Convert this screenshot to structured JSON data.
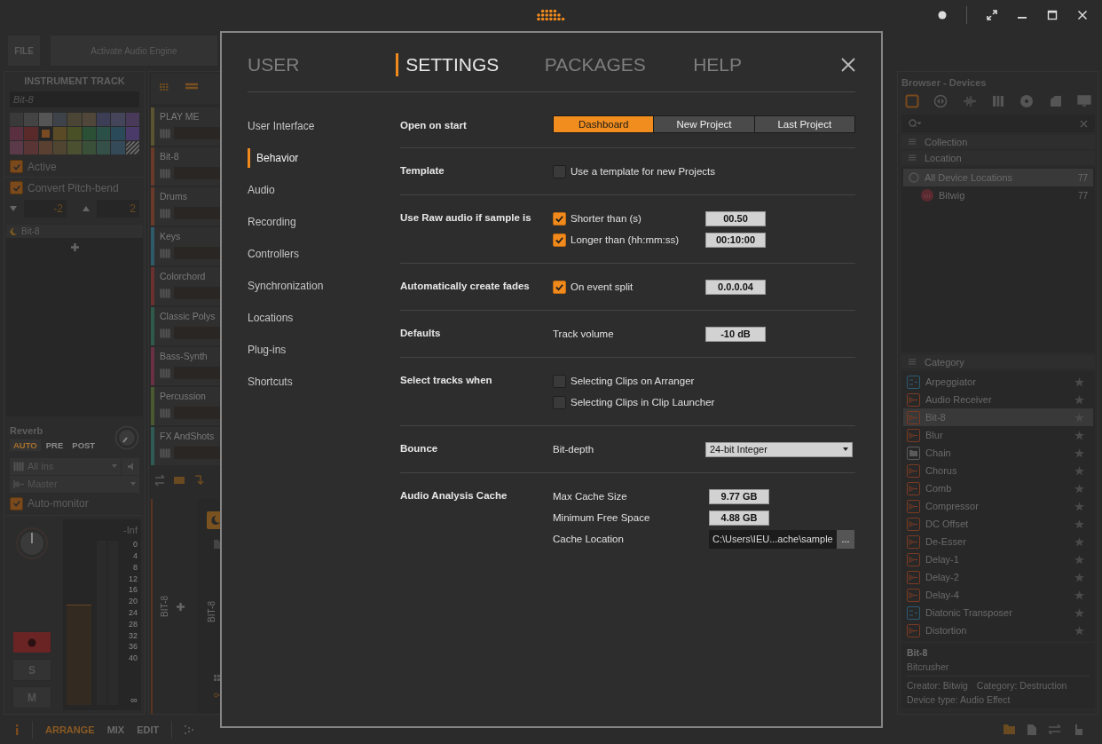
{
  "toolbar": {
    "file_button": "FILE",
    "engine_button": "Activate Audio Engine"
  },
  "inspector": {
    "title": "INSTRUMENT TRACK",
    "name": "Bit-8",
    "swatches": [
      {
        "color": "#3a3a3a",
        "selected": false
      },
      {
        "color": "#444444",
        "selected": false
      },
      {
        "color": "#555555",
        "selected": false
      },
      {
        "color": "#3e4249",
        "selected": false
      },
      {
        "color": "#4a4535",
        "selected": false
      },
      {
        "color": "#50473a",
        "selected": false
      },
      {
        "color": "#3b3e55",
        "selected": false
      },
      {
        "color": "#44445a",
        "selected": false
      },
      {
        "color": "#4a3a5a",
        "selected": false
      },
      {
        "color": "#5a3040",
        "selected": false
      },
      {
        "color": "#5a2a2a",
        "selected": false
      },
      {
        "color": "#7a4a22",
        "selected": true
      },
      {
        "color": "#5a4a25",
        "selected": false
      },
      {
        "color": "#4a5025",
        "selected": false
      },
      {
        "color": "#2a5035",
        "selected": false
      },
      {
        "color": "#2a5048",
        "selected": false
      },
      {
        "color": "#2a4a5a",
        "selected": false
      },
      {
        "color": "#4a3a6a",
        "selected": false
      },
      {
        "color": "#5a3a48",
        "selected": false
      },
      {
        "color": "#5a3535",
        "selected": false
      },
      {
        "color": "#5a4030",
        "selected": false
      },
      {
        "color": "#504530",
        "selected": false
      },
      {
        "color": "#4a5030",
        "selected": false
      },
      {
        "color": "#3a5038",
        "selected": false
      },
      {
        "color": "#355048",
        "selected": false
      },
      {
        "color": "#354a58",
        "selected": false
      }
    ],
    "active": {
      "label": "Active",
      "checked": true
    },
    "pitch_bend": {
      "label": "Convert Pitch-bend",
      "checked": true,
      "down": "-2",
      "up": "2"
    },
    "device": "Bit-8",
    "send": {
      "name": "Reverb",
      "modes": [
        {
          "label": "AUTO",
          "selected": true
        },
        {
          "label": "PRE",
          "selected": false
        },
        {
          "label": "POST",
          "selected": false
        }
      ]
    },
    "input": "All ins",
    "output": "Master",
    "auto_monitor": {
      "label": "Auto-monitor",
      "checked": true
    },
    "meter": {
      "peak": "-Inf",
      "level": 0.55,
      "scale": [
        "0",
        "4",
        "8",
        "12",
        "16",
        "20",
        "24",
        "28",
        "32",
        "36",
        "40"
      ],
      "bottom": "∞"
    },
    "buttons": [
      "S",
      "M"
    ]
  },
  "tracks": [
    {
      "name": "PLAY ME",
      "color": "#5a5530"
    },
    {
      "name": "Bit-8",
      "color": "#6a3a28"
    },
    {
      "name": "Drums",
      "color": "#6a3a28"
    },
    {
      "name": "Keys",
      "color": "#2f5a6a"
    },
    {
      "name": "Colorchord",
      "color": "#6a3030"
    },
    {
      "name": "Classic Polys",
      "color": "#2f5a4a"
    },
    {
      "name": "Bass-Synth",
      "color": "#6a3045"
    },
    {
      "name": "Percussion",
      "color": "#4a5a30"
    },
    {
      "name": "FX AndShots",
      "color": "#2f5a55"
    }
  ],
  "mixer": {
    "strip_label": "BIT-8",
    "chain_label": "BIT-8"
  },
  "browser": {
    "title": "Browser - Devices",
    "tabs": [
      {
        "kind": "device",
        "selected": true
      },
      {
        "kind": "preset",
        "selected": false
      },
      {
        "kind": "sample",
        "selected": false
      },
      {
        "kind": "multisample",
        "selected": false
      },
      {
        "kind": "disk",
        "selected": false
      },
      {
        "kind": "clip",
        "selected": false
      },
      {
        "kind": "computer",
        "selected": false
      }
    ],
    "sections": [
      "Collection",
      "Location"
    ],
    "locations": [
      {
        "name": "All Device Locations",
        "count": "77",
        "selected": true
      },
      {
        "name": "Bitwig",
        "count": "77",
        "selected": false
      }
    ],
    "category_header": "Category",
    "devices": [
      {
        "name": "Arpeggiator",
        "kind": "note",
        "selected": false
      },
      {
        "name": "Audio Receiver",
        "kind": "audio",
        "selected": false
      },
      {
        "name": "Bit-8",
        "kind": "audio",
        "selected": true
      },
      {
        "name": "Blur",
        "kind": "audio",
        "selected": false
      },
      {
        "name": "Chain",
        "kind": "container",
        "selected": false
      },
      {
        "name": "Chorus",
        "kind": "audio",
        "selected": false
      },
      {
        "name": "Comb",
        "kind": "audio",
        "selected": false
      },
      {
        "name": "Compressor",
        "kind": "audio",
        "selected": false
      },
      {
        "name": "DC Offset",
        "kind": "audio",
        "selected": false
      },
      {
        "name": "De-Esser",
        "kind": "audio",
        "selected": false
      },
      {
        "name": "Delay-1",
        "kind": "audio",
        "selected": false
      },
      {
        "name": "Delay-2",
        "kind": "audio",
        "selected": false
      },
      {
        "name": "Delay-4",
        "kind": "audio",
        "selected": false
      },
      {
        "name": "Diatonic Transposer",
        "kind": "note",
        "selected": false
      },
      {
        "name": "Distortion",
        "kind": "audio",
        "selected": false
      }
    ],
    "info": {
      "name": "Bit-8",
      "description": "Bitcrusher",
      "creator": "Creator: Bitwig",
      "category": "Category: Destruction",
      "type": "Device type: Audio Effect"
    }
  },
  "bottom_bar": {
    "views": [
      {
        "label": "ARRANGE",
        "selected": true
      },
      {
        "label": "MIX",
        "selected": false
      },
      {
        "label": "EDIT",
        "selected": false
      }
    ]
  },
  "dialog": {
    "tabs": [
      {
        "label": "USER",
        "selected": false
      },
      {
        "label": "SETTINGS",
        "selected": true
      },
      {
        "label": "PACKAGES",
        "selected": false
      },
      {
        "label": "HELP",
        "selected": false
      }
    ],
    "sections": [
      {
        "label": "User Interface",
        "selected": false
      },
      {
        "label": "Behavior",
        "selected": true
      },
      {
        "label": "Audio",
        "selected": false
      },
      {
        "label": "Recording",
        "selected": false
      },
      {
        "label": "Controllers",
        "selected": false
      },
      {
        "label": "Synchronization",
        "selected": false
      },
      {
        "label": "Locations",
        "selected": false
      },
      {
        "label": "Plug-ins",
        "selected": false
      },
      {
        "label": "Shortcuts",
        "selected": false
      }
    ],
    "rows": [
      {
        "label": "Open on start",
        "items": [
          {
            "kind": "segmented",
            "options": [
              {
                "label": "Dashboard",
                "selected": true
              },
              {
                "label": "New Project",
                "selected": false
              },
              {
                "label": "Last Project",
                "selected": false
              }
            ]
          }
        ]
      },
      {
        "label": "Template",
        "items": [
          {
            "kind": "checkbox",
            "label": "Use a template for new Projects",
            "checked": false
          }
        ]
      },
      {
        "label": "Use Raw audio if sample is",
        "items": [
          {
            "kind": "checkbox",
            "label": "Shorter than (s)",
            "checked": true,
            "value": "00.50"
          },
          {
            "kind": "checkbox",
            "label": "Longer than (hh:mm:ss)",
            "checked": true,
            "value": "00:10:00"
          }
        ]
      },
      {
        "label": "Automatically create fades",
        "items": [
          {
            "kind": "checkbox",
            "label": "On event split",
            "checked": true,
            "value": "0.0.0.04"
          }
        ]
      },
      {
        "label": "Defaults",
        "items": [
          {
            "kind": "field",
            "label": "Track volume",
            "value": "-10 dB"
          }
        ]
      },
      {
        "label": "Select tracks when",
        "items": [
          {
            "kind": "checkbox",
            "label": "Selecting Clips on Arranger",
            "checked": false
          },
          {
            "kind": "checkbox",
            "label": "Selecting Clips in Clip Launcher",
            "checked": false
          }
        ]
      },
      {
        "label": "Bounce",
        "items": [
          {
            "kind": "dropdown",
            "label": "Bit-depth",
            "value": "24-bit Integer"
          }
        ]
      },
      {
        "label": "Audio Analysis Cache",
        "items": [
          {
            "kind": "field",
            "label": "Max Cache Size",
            "value": "9.77 GB"
          },
          {
            "kind": "field",
            "label": "Minimum Free Space",
            "value": "4.88 GB"
          },
          {
            "kind": "path",
            "label": "Cache Location",
            "value": "C:\\Users\\IEU...ache\\sample",
            "button": "..."
          }
        ]
      }
    ]
  }
}
